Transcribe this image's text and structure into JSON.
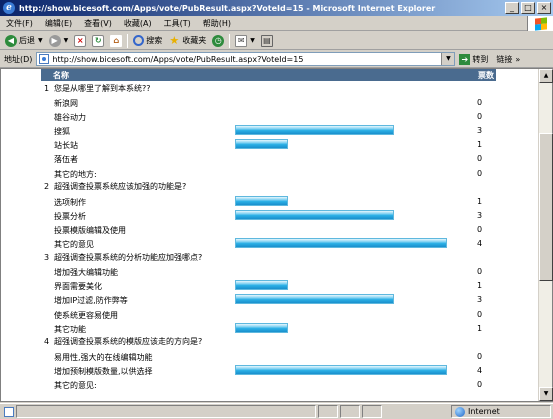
{
  "window": {
    "title": "http://show.bicesoft.com/Apps/vote/PubResult.aspx?VoteId=15 - Microsoft Internet Explorer",
    "buttons": [
      "_",
      "□",
      "×"
    ]
  },
  "menu": [
    "文件(F)",
    "编辑(E)",
    "查看(V)",
    "收藏(A)",
    "工具(T)",
    "帮助(H)"
  ],
  "toolbar": {
    "back": "后退",
    "search": "搜索",
    "favorites": "收藏夹"
  },
  "address": {
    "label": "地址(D)",
    "url": "http://show.bicesoft.com/Apps/vote/PubResult.aspx?VoteId=15",
    "go": "转到",
    "links": "链接"
  },
  "results": {
    "header_name": "名称",
    "header_votes": "票数",
    "questions": [
      {
        "num": "1",
        "text": "您是从哪里了解到本系统??",
        "options": [
          {
            "label": "新浪网",
            "count": "0",
            "votes": 0
          },
          {
            "label": "雄谷动力",
            "count": "0",
            "votes": 0
          },
          {
            "label": "搜狐",
            "count": "3",
            "votes": 3
          },
          {
            "label": "站长站",
            "count": "1",
            "votes": 1
          },
          {
            "label": "落伍者",
            "count": "0",
            "votes": 0
          },
          {
            "label": "其它的地方:",
            "count": "0",
            "votes": 0
          }
        ]
      },
      {
        "num": "2",
        "text": "超强调查投票系统应该加强的功能是?",
        "options": [
          {
            "label": "选项制作",
            "count": "1",
            "votes": 1
          },
          {
            "label": "投票分析",
            "count": "3",
            "votes": 3
          },
          {
            "label": "投票模版编辑及使用",
            "count": "0",
            "votes": 0
          },
          {
            "label": "其它的意见",
            "count": "4",
            "votes": 4
          }
        ]
      },
      {
        "num": "3",
        "text": "超强调查投票系统的分析功能应加强哪点?",
        "options": [
          {
            "label": "增加强大编辑功能",
            "count": "0",
            "votes": 0
          },
          {
            "label": "界面需要美化",
            "count": "1",
            "votes": 1
          },
          {
            "label": "增加IP过滤,防作弊等",
            "count": "3",
            "votes": 3
          },
          {
            "label": "使系统更容易使用",
            "count": "0",
            "votes": 0
          },
          {
            "label": "其它功能",
            "count": "1",
            "votes": 1
          }
        ]
      },
      {
        "num": "4",
        "text": "超强调查投票系统的模版应该走的方向是?",
        "options": [
          {
            "label": "易用性,强大的在线编辑功能",
            "count": "0",
            "votes": 0
          },
          {
            "label": "增加预制模版数量,以供选择",
            "count": "4",
            "votes": 4
          },
          {
            "label": "其它的意见:",
            "count": "0",
            "votes": 0
          }
        ]
      }
    ]
  },
  "status": {
    "zone": "Internet"
  }
}
